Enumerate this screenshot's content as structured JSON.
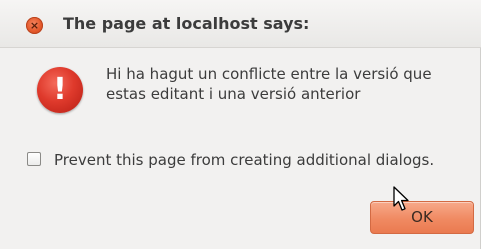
{
  "dialog": {
    "title": "The page at localhost says:",
    "close_icon": "close-icon",
    "close_glyph": "×",
    "message_icon": "error-icon",
    "message_icon_glyph": "!",
    "message_lines": [
      "Hi ha hagut un conflicte entre la versió que",
      "estas editant i una versió anterior"
    ],
    "checkbox": {
      "label": "Prevent this page from creating additional dialogs.",
      "checked": false
    },
    "ok_label": "OK"
  },
  "colors": {
    "close_button": "#e4582a",
    "error_icon": "#df3a2c",
    "ok_button": "#f08a62",
    "dialog_background": "#f2f1f0",
    "text": "#3c3c3c"
  }
}
